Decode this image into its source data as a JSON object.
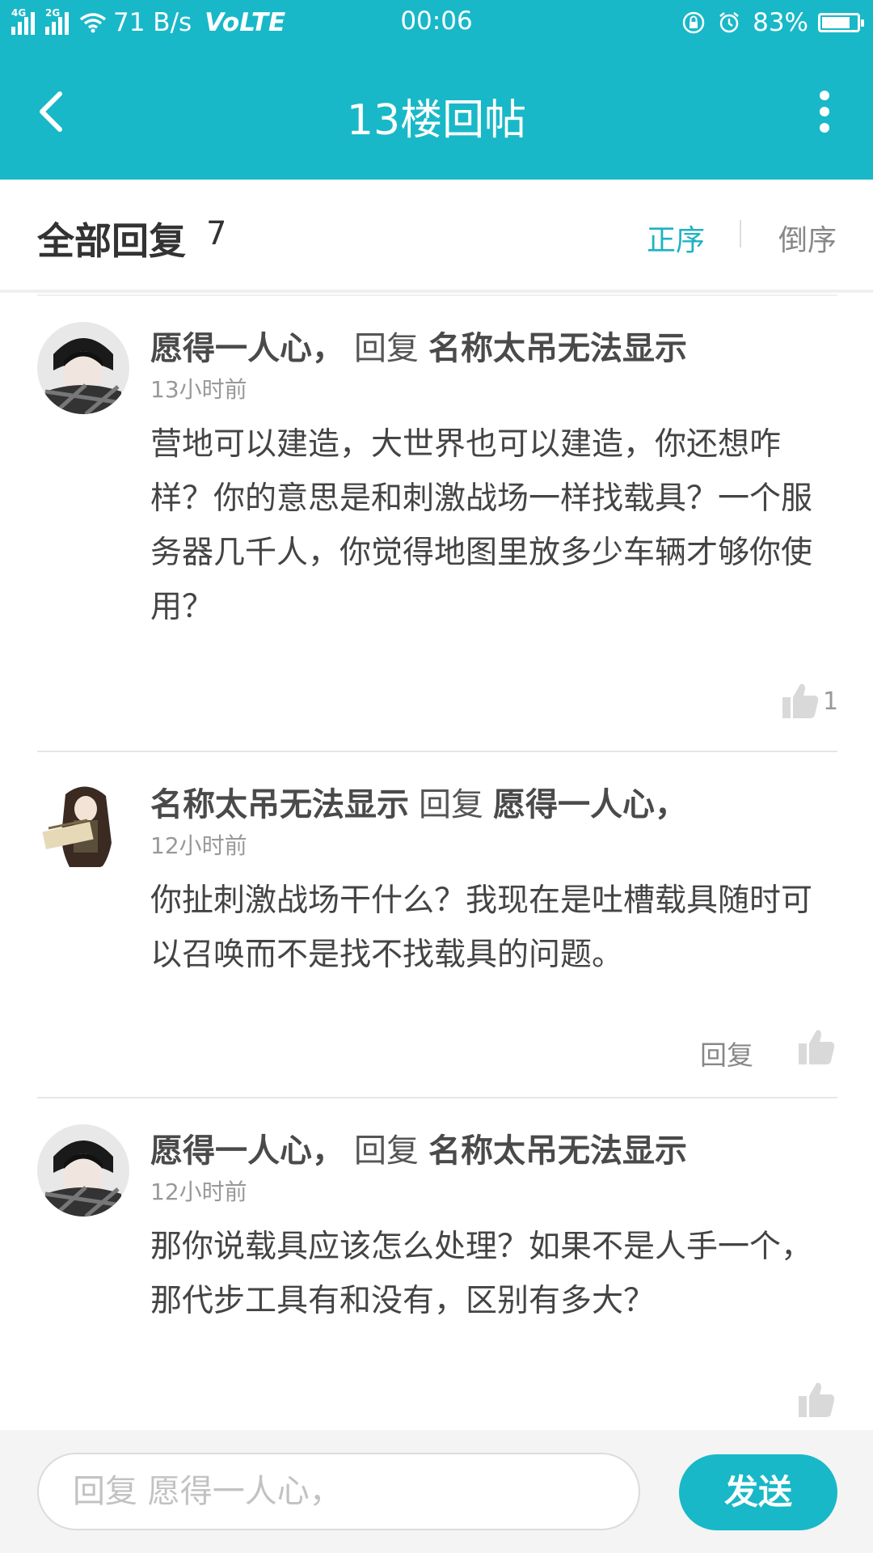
{
  "status_bar": {
    "network_1": "4G",
    "network_2": "2G",
    "speed": "71 B/s",
    "volte": "VoLTE",
    "time": "00:06",
    "battery_percent": "83%",
    "battery_level": 0.83
  },
  "nav": {
    "title": "13楼回帖",
    "back_icon": "back-arrow-icon",
    "more_icon": "more-vertical-icon"
  },
  "replies_header": {
    "title": "全部回复",
    "count": "7",
    "sort_asc": "正序",
    "sort_desc": "倒序",
    "active_sort": "正序"
  },
  "colors": {
    "accent": "#18b8c8",
    "active_sort": "#1eb2c4"
  },
  "replies": [
    {
      "author": "愿得一人心，",
      "action": "回复",
      "target": "名称太吊无法显示",
      "time": "13小时前",
      "text": "营地可以建造，大世界也可以建造，你还想咋样？你的意思是和刺激战场一样找载具？一个服务器几千人，你觉得地图里放多少车辆才够你使用？",
      "likes": "1",
      "avatar": "avatar-boy"
    },
    {
      "author": "名称太吊无法显示",
      "action": "回复",
      "target": "愿得一人心，",
      "time": "12小时前",
      "text": "你扯刺激战场干什么？我现在是吐槽载具随时可以召唤而不是找不找载具的问题。",
      "reply_label": "回复",
      "avatar": "avatar-anime-girl"
    },
    {
      "author": "愿得一人心，",
      "action": "回复",
      "target": "名称太吊无法显示",
      "time": "12小时前",
      "text": "那你说载具应该怎么处理？如果不是人手一个，那代步工具有和没有，区别有多大？",
      "avatar": "avatar-boy"
    }
  ],
  "bottom": {
    "input_placeholder": "回复 愿得一人心，",
    "send_label": "发送"
  }
}
